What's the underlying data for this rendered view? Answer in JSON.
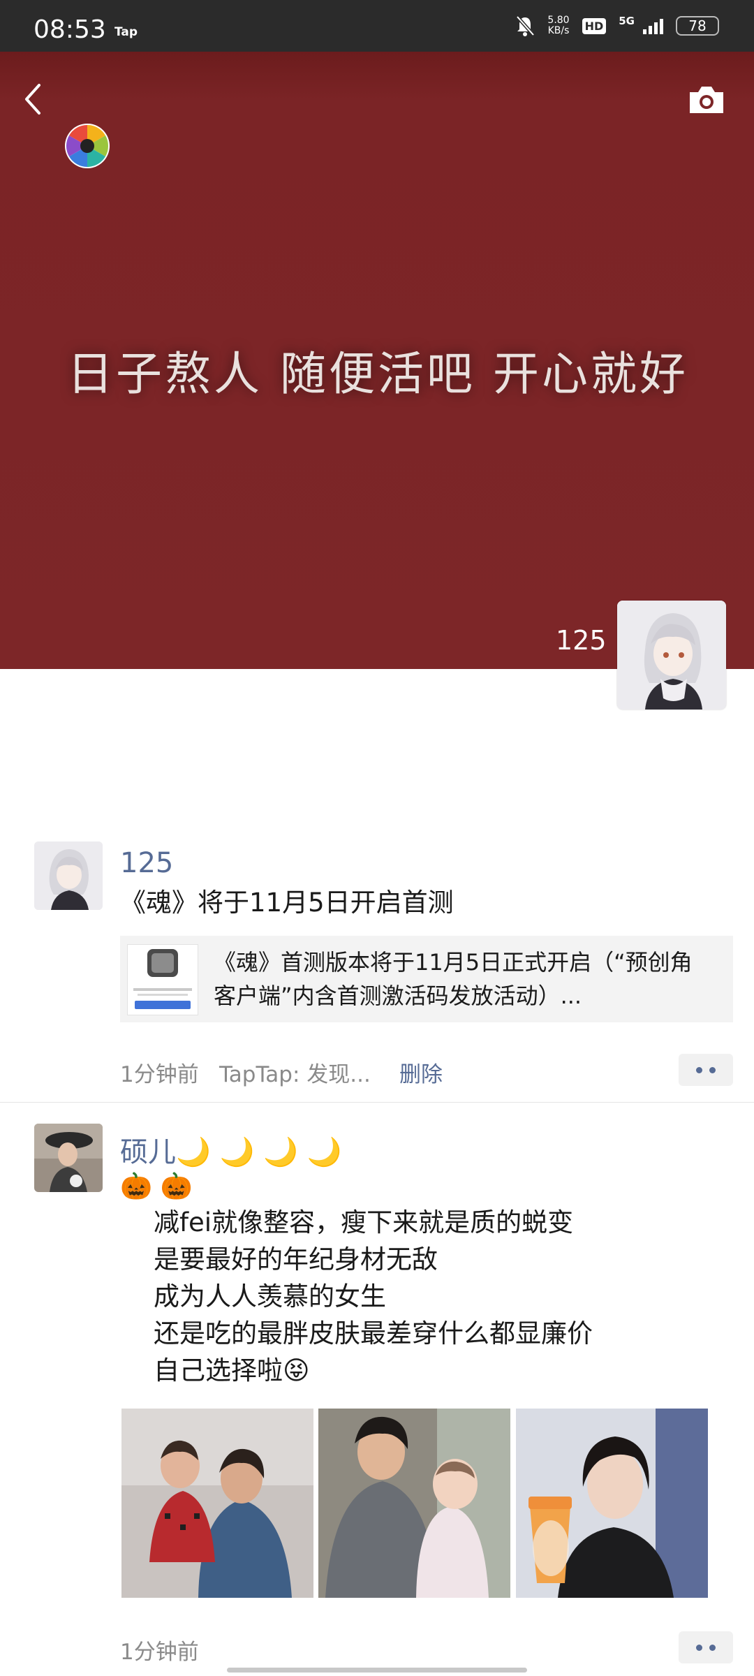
{
  "status_bar": {
    "time": "08:53",
    "app_badge": "Tap",
    "net_speed_value": "5.80",
    "net_speed_unit": "KB/s",
    "hd_label": "HD",
    "network_label": "5G",
    "battery": "78",
    "icons": [
      "mute-bell-icon",
      "signal-icon",
      "battery-icon"
    ]
  },
  "cover": {
    "text": "日子熬人 随便活吧 开心就好",
    "user_name": "125",
    "background_color": "#7d2628",
    "icons": [
      "back-icon",
      "camera-icon",
      "lens-icon"
    ]
  },
  "posts": [
    {
      "name": "125",
      "text": "《魂》将于11月5日开启首测",
      "link": {
        "text": "《魂》首测版本将于11月5日正式开启（“预创角\n客户端”内含首测激活码发放活动）..."
      },
      "time": "1分钟前",
      "source": "TapTap: 发现...",
      "delete_label": "删除"
    },
    {
      "name": "硕儿🌙 🌙 🌙 🌙",
      "emoji_line": "🎃 🎃",
      "text": "减fei就像整容，瘦下来就是质的蜕变\n是要最好的年纪身材无敌\n成为人人羡慕的女生\n还是吃的最胖皮肤最差穿什么都显廉价\n自己选择啦😝",
      "time": "1分钟前"
    }
  ],
  "colors": {
    "name_link": "#566b95",
    "meta_gray": "#8a8a8a",
    "status_bar": "#2b2b2b"
  }
}
